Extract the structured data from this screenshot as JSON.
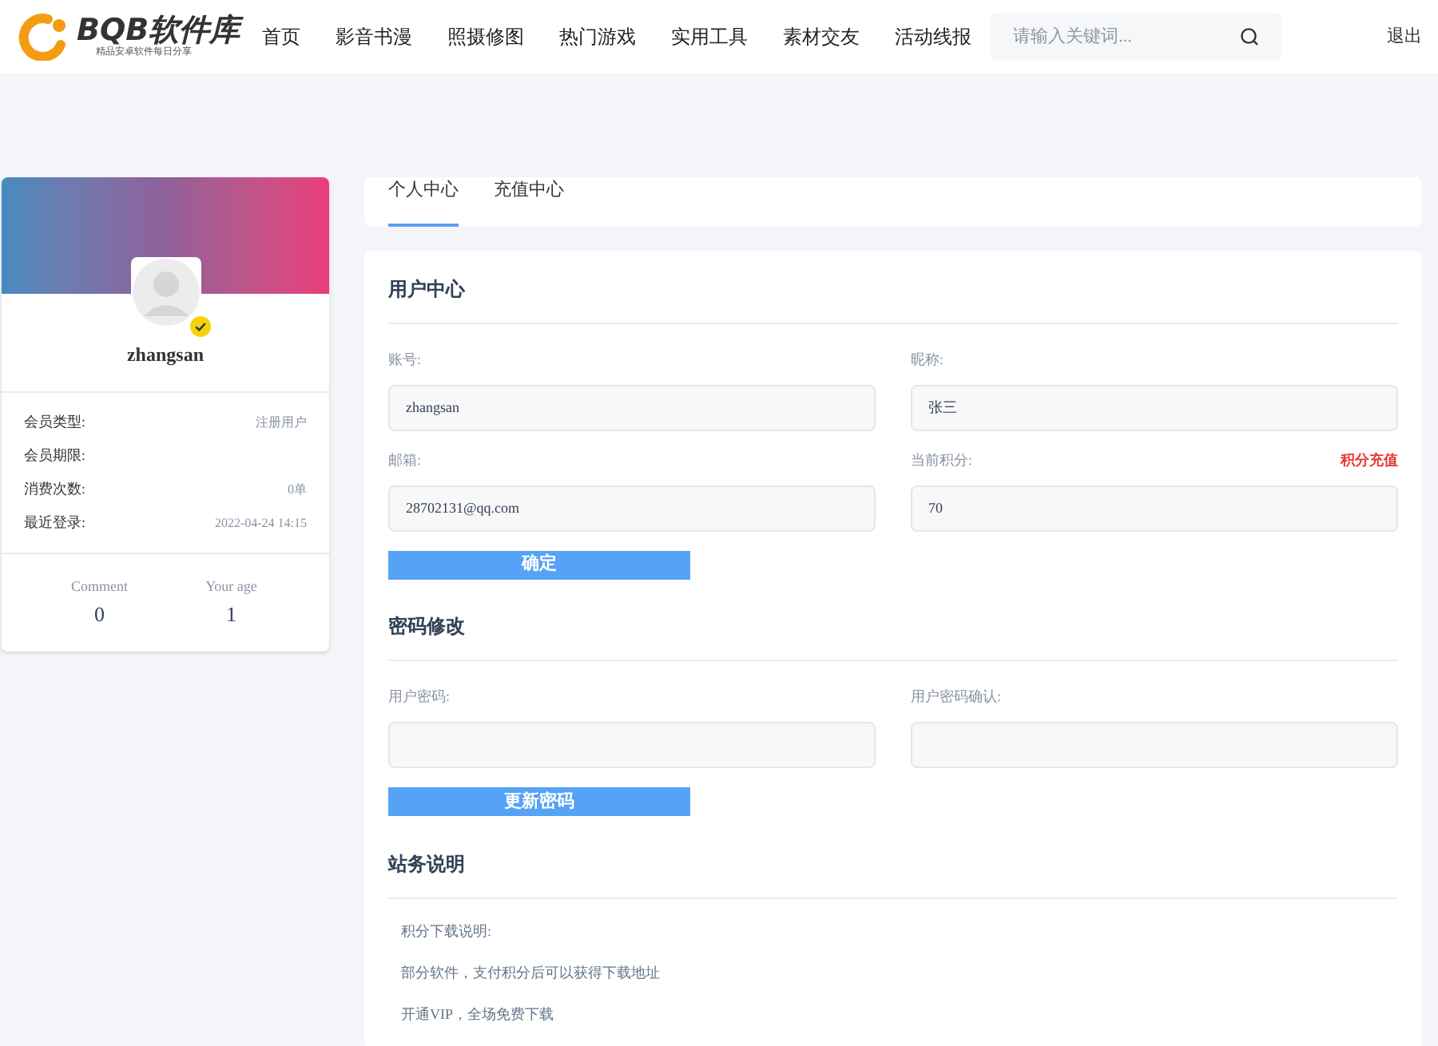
{
  "header": {
    "logo": {
      "name": "BQB软件库",
      "tagline": "精品安卓软件每日分享"
    },
    "nav": [
      {
        "label": "首页"
      },
      {
        "label": "影音书漫"
      },
      {
        "label": "照摄修图"
      },
      {
        "label": "热门游戏"
      },
      {
        "label": "实用工具"
      },
      {
        "label": "素材交友"
      },
      {
        "label": "活动线报"
      }
    ],
    "search": {
      "placeholder": "请输入关键词..."
    },
    "logout": "退出"
  },
  "profile": {
    "username": "zhangsan",
    "verified": true,
    "info": [
      {
        "label": "会员类型:",
        "value": "注册用户"
      },
      {
        "label": "会员期限:"
      },
      {
        "label": "消费次数:",
        "value": "0单"
      },
      {
        "label": "最近登录:",
        "value": "2022-04-24 14:15"
      }
    ],
    "stats": [
      {
        "label": "Comment",
        "value": "0"
      },
      {
        "label": "Your age",
        "value": "1"
      }
    ]
  },
  "tabs": [
    {
      "label": "个人中心",
      "selected": true
    },
    {
      "label": "充值中心",
      "selected": false
    }
  ],
  "user_center": {
    "title": "用户中心",
    "fields": [
      {
        "label": "账号:",
        "value": "zhangsan"
      },
      {
        "label": "昵称:",
        "value": "张三"
      },
      {
        "label": "邮箱:",
        "value": "28702131@qq.com"
      },
      {
        "label": "当前积分:",
        "value": "70",
        "link": "积分充值"
      }
    ],
    "button": "确定"
  },
  "password": {
    "title": "密码修改",
    "fields": [
      {
        "label": "用户密码:"
      },
      {
        "label": "用户密码确认:"
      }
    ],
    "button": "更新密码"
  },
  "notice": {
    "title": "站务说明",
    "lines": [
      "积分下载说明:",
      "部分软件，支付积分后可以获得下载地址",
      "开通VIP，全场免费下载"
    ]
  }
}
